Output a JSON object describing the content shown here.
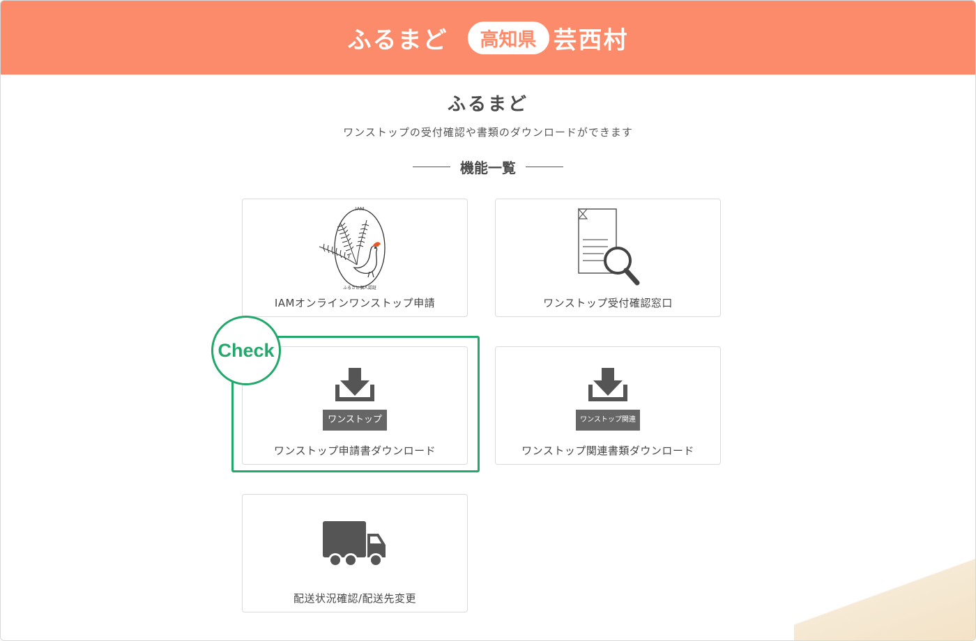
{
  "header": {
    "brand": "ふるまど",
    "prefecture": "高知県",
    "village": "芸西村",
    "bg_color": "#fb8b6a"
  },
  "main": {
    "title": "ふるまど",
    "subtitle": "ワンストップの受付確認や書類のダウンロードができます",
    "section_label": "機能一覧"
  },
  "cards": [
    {
      "id": "iam",
      "label": "IAMオンラインワンストップ申請",
      "icon": "iam-pheasant-logo-icon",
      "logo_text_top": "IAM",
      "logo_text_bottom": "ふるさと個人認証"
    },
    {
      "id": "receipt",
      "label": "ワンストップ受付確認窓口",
      "icon": "document-search-icon"
    },
    {
      "id": "application-download",
      "label": "ワンストップ申請書ダウンロード",
      "icon": "download-icon",
      "tag": "ワンストップ"
    },
    {
      "id": "related-download",
      "label": "ワンストップ関連書類ダウンロード",
      "icon": "download-icon",
      "tag": "ワンストップ関連"
    },
    {
      "id": "delivery",
      "label": "配送状況確認/配送先変更",
      "icon": "truck-icon"
    }
  ],
  "annotation": {
    "badge": "Check",
    "color": "#22a86a"
  }
}
